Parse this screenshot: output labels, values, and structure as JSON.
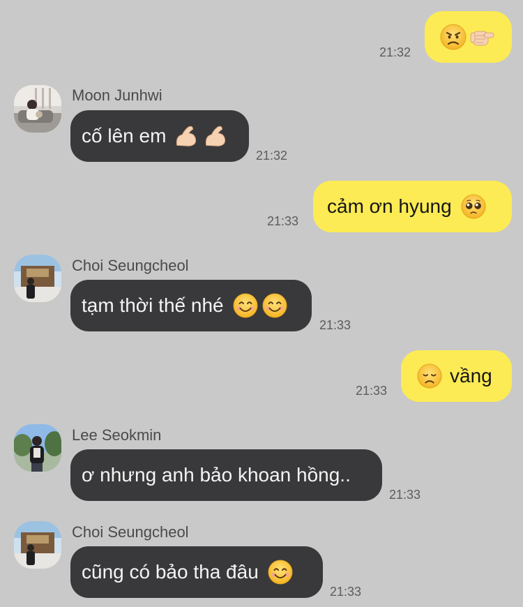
{
  "messages": [
    {
      "id": "m1",
      "direction": "outgoing",
      "text": "",
      "emoji_after": [
        "angry-face",
        "pointing-hand"
      ],
      "time": "21:32"
    },
    {
      "id": "m2",
      "direction": "incoming",
      "sender": "Moon Junhwi",
      "avatar": "avatar-moon-junhwi",
      "text": "cố lên em",
      "emoji_after": [
        "flexed-biceps",
        "flexed-biceps"
      ],
      "time": "21:32"
    },
    {
      "id": "m3",
      "direction": "outgoing",
      "text": "cảm ơn hyung",
      "emoji_after": [
        "pleading-face"
      ],
      "time": "21:33"
    },
    {
      "id": "m4",
      "direction": "incoming",
      "sender": "Choi Seungcheol",
      "avatar": "avatar-choi-seungcheol",
      "text": "tạm thời thế nhé",
      "emoji_after": [
        "smiling-face",
        "smiling-face"
      ],
      "time": "21:33"
    },
    {
      "id": "m5",
      "direction": "outgoing",
      "text": "vầng",
      "emoji_before": [
        "disappointed-face"
      ],
      "time": "21:33"
    },
    {
      "id": "m6",
      "direction": "incoming",
      "sender": "Lee Seokmin",
      "avatar": "avatar-lee-seokmin",
      "text": "ơ nhưng anh bảo khoan hồng..",
      "time": "21:33"
    },
    {
      "id": "m7",
      "direction": "incoming",
      "sender": "Choi Seungcheol",
      "avatar": "avatar-choi-seungcheol",
      "text": "cũng có bảo tha đâu",
      "emoji_after": [
        "smiling-face"
      ],
      "time": "21:33"
    }
  ],
  "colors": {
    "background": "#c9c9c9",
    "outgoing_bubble": "#fceb54",
    "incoming_bubble": "#39393b",
    "incoming_text": "#f4f4f4",
    "outgoing_text": "#161616",
    "timestamp": "#5c5c5c",
    "sender_name": "#4a4a4a"
  }
}
